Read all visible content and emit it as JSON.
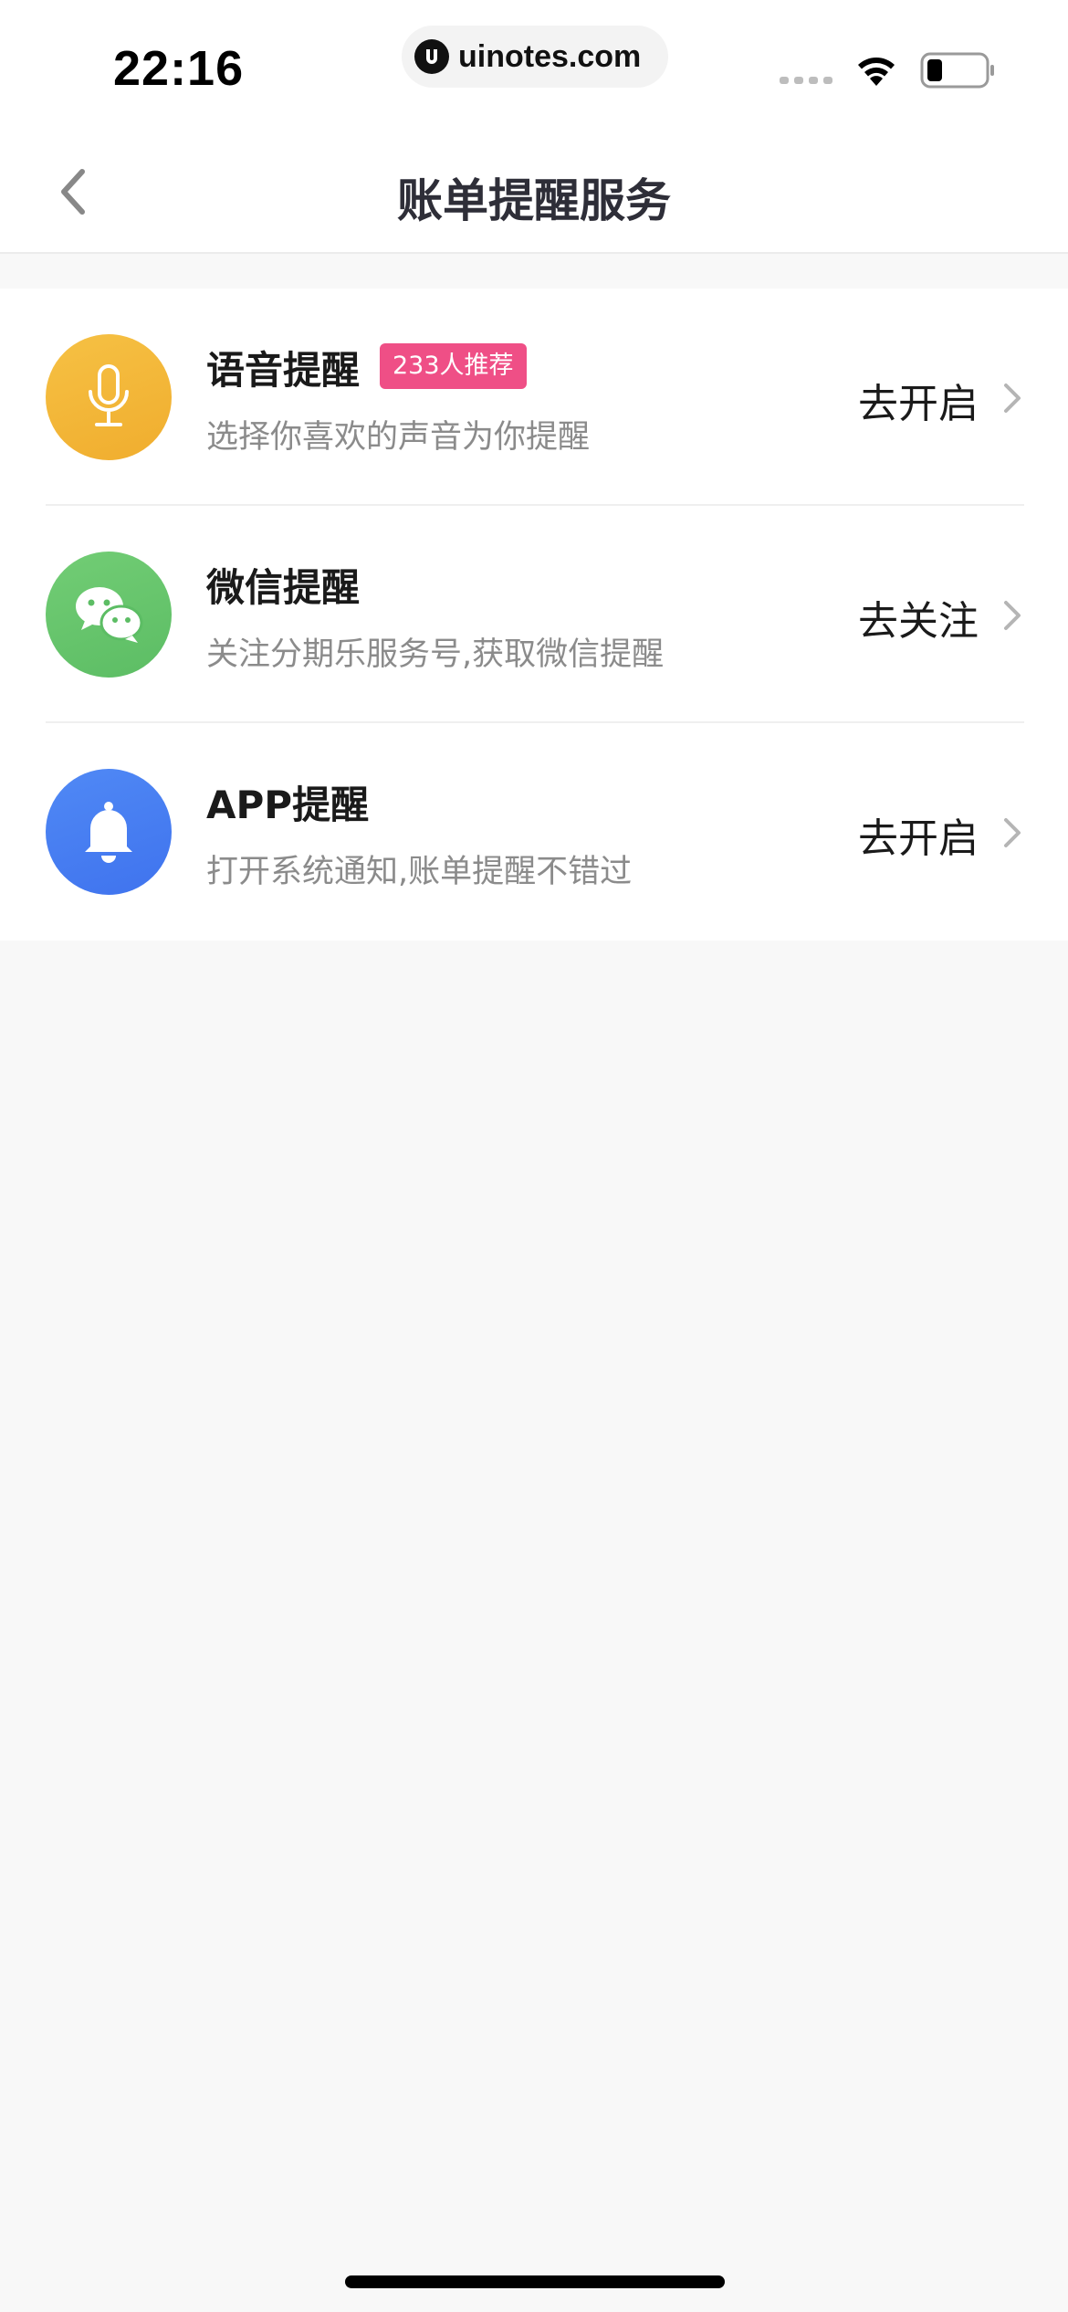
{
  "status": {
    "time": "22:16",
    "url": "uinotes.com"
  },
  "nav": {
    "title": "账单提醒服务"
  },
  "colors": {
    "voice": "#f3b638",
    "wechat": "#66c66c",
    "app": "#4a7ef2",
    "badge": "#ef4f86"
  },
  "items": [
    {
      "title": "语音提醒",
      "badge": "233人推荐",
      "subtitle": "选择你喜欢的声音为你提醒",
      "action": "去开启",
      "icon": "microphone-icon"
    },
    {
      "title": "微信提醒",
      "subtitle": "关注分期乐服务号,获取微信提醒",
      "action": "去关注",
      "icon": "wechat-icon"
    },
    {
      "title": "APP提醒",
      "subtitle": "打开系统通知,账单提醒不错过",
      "action": "去开启",
      "icon": "bell-icon"
    }
  ]
}
